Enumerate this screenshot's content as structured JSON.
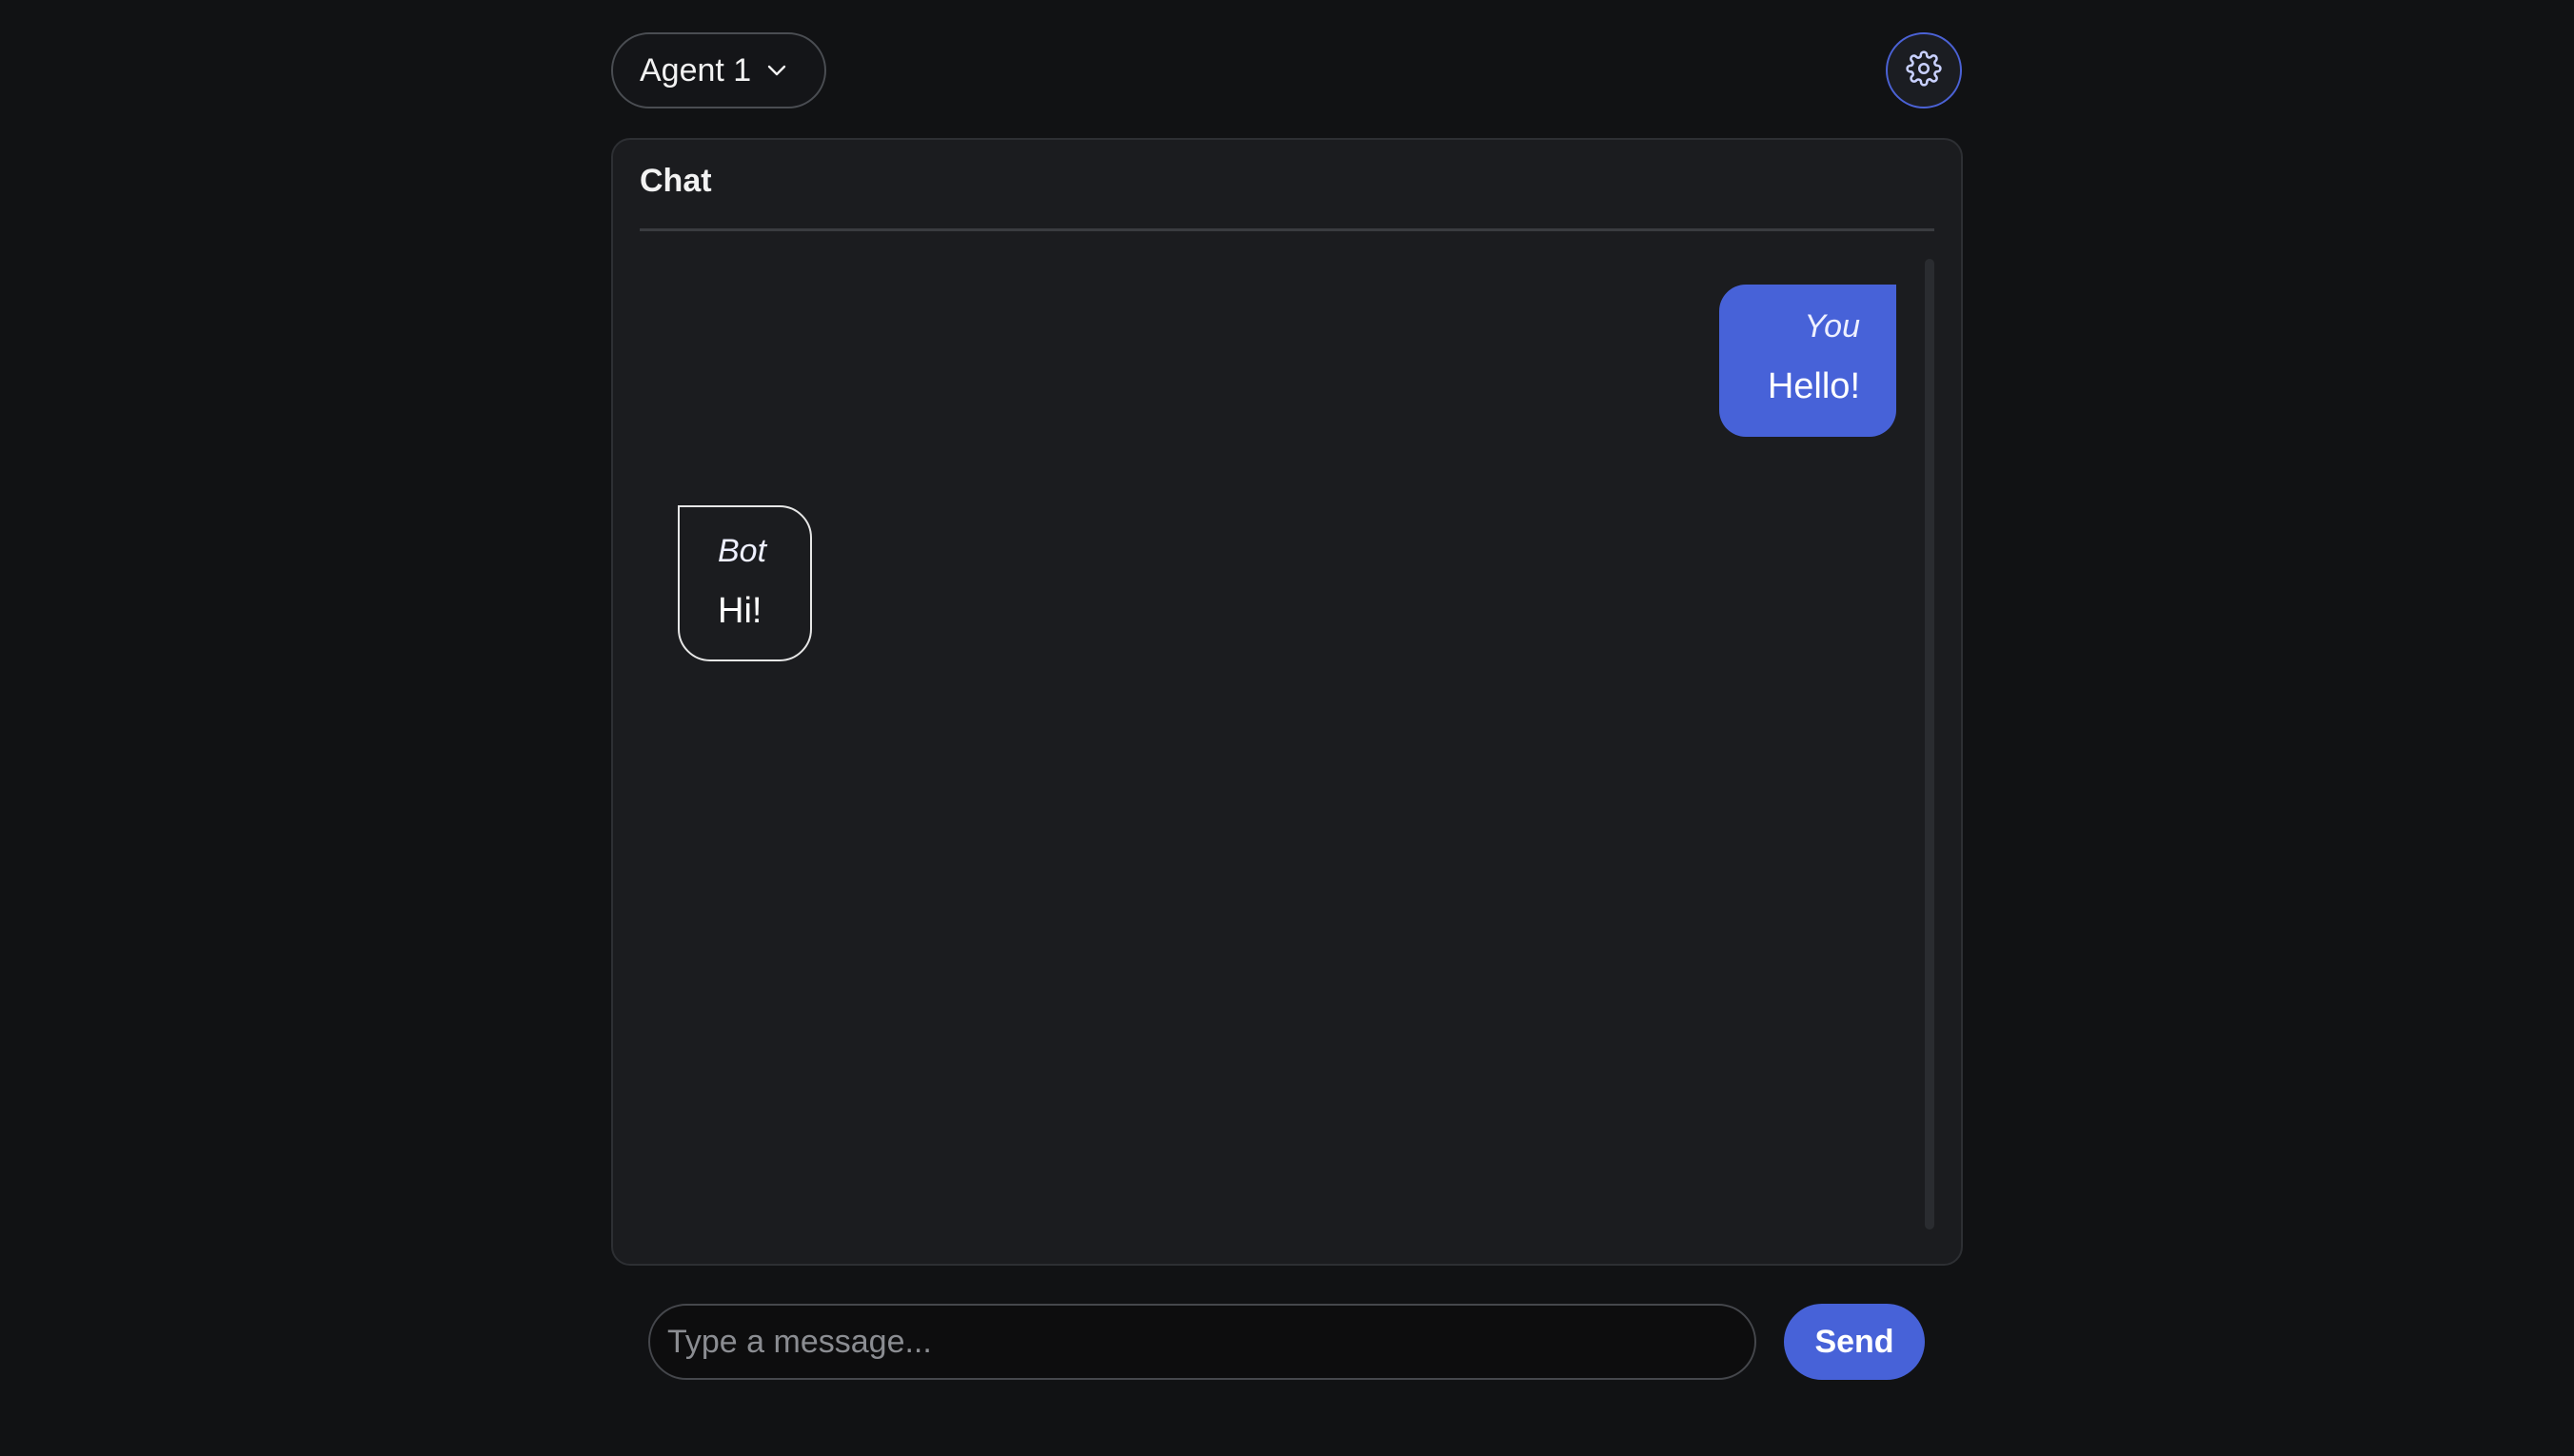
{
  "header": {
    "agent_selector": {
      "selected": "Agent 1"
    },
    "settings_icon": "gear-icon",
    "chevron_icon": "chevron-down-icon"
  },
  "chat": {
    "title": "Chat",
    "messages": [
      {
        "sender": "You",
        "text": "Hello!",
        "role": "user"
      },
      {
        "sender": "Bot",
        "text": "Hi!",
        "role": "bot"
      }
    ]
  },
  "composer": {
    "placeholder": "Type a message...",
    "value": "",
    "send_label": "Send"
  },
  "colors": {
    "background": "#111214",
    "panel": "#1b1c1f",
    "accent": "#4762d8",
    "input_background": "#0d0d0e"
  }
}
